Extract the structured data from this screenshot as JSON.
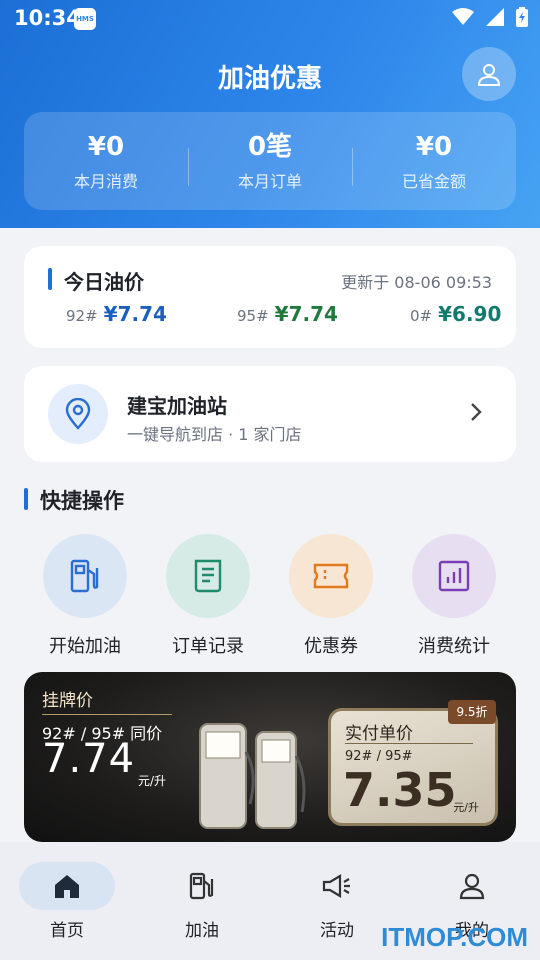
{
  "status_bar": {
    "time": "10:34",
    "badge": "HMS"
  },
  "header": {
    "title": "加油优惠",
    "stats": [
      {
        "value": "¥0",
        "label": "本月消费"
      },
      {
        "value": "0笔",
        "label": "本月订单"
      },
      {
        "value": "¥0",
        "label": "已省金额"
      }
    ]
  },
  "price_card": {
    "title": "今日油价",
    "updated": "更新于 08-06 09:53",
    "prices": [
      {
        "grade": "92#",
        "price": "¥7.74",
        "color": "#1b5fbf"
      },
      {
        "grade": "95#",
        "price": "¥7.74",
        "color": "#1f7a3c"
      },
      {
        "grade": "0#",
        "price": "¥6.90",
        "color": "#157a6e"
      }
    ]
  },
  "station": {
    "name": "建宝加油站",
    "subtitle": "一键导航到店 · 1 家门店"
  },
  "quick_actions": {
    "title": "快捷操作",
    "items": [
      {
        "label": "开始加油",
        "icon": "fuel-pump-icon",
        "bg": "#dbe6f5",
        "color": "#2a6fd0"
      },
      {
        "label": "订单记录",
        "icon": "receipt-icon",
        "bg": "#d6ebe6",
        "color": "#1f8a6c"
      },
      {
        "label": "优惠券",
        "icon": "ticket-icon",
        "bg": "#f8e6d4",
        "color": "#e07a1f"
      },
      {
        "label": "消费统计",
        "icon": "bar-chart-icon",
        "bg": "#e7dff1",
        "color": "#7b3fb5"
      }
    ]
  },
  "banner": {
    "list_title": "挂牌价",
    "list_grades": "92# / 95# 同价",
    "list_price": "7.74",
    "list_unit": "元/升",
    "real_title": "实付单价",
    "real_grades": "92# / 95#",
    "real_price": "7.35",
    "real_unit": "元/升",
    "discount": "9.5折"
  },
  "tab_bar": {
    "tabs": [
      {
        "label": "首页",
        "icon": "home-icon",
        "active": true
      },
      {
        "label": "加油",
        "icon": "fuel-pump-icon",
        "active": false
      },
      {
        "label": "活动",
        "icon": "megaphone-icon",
        "active": false
      },
      {
        "label": "我的",
        "icon": "user-icon",
        "active": false
      }
    ]
  },
  "watermark": "ITMOP.COM"
}
